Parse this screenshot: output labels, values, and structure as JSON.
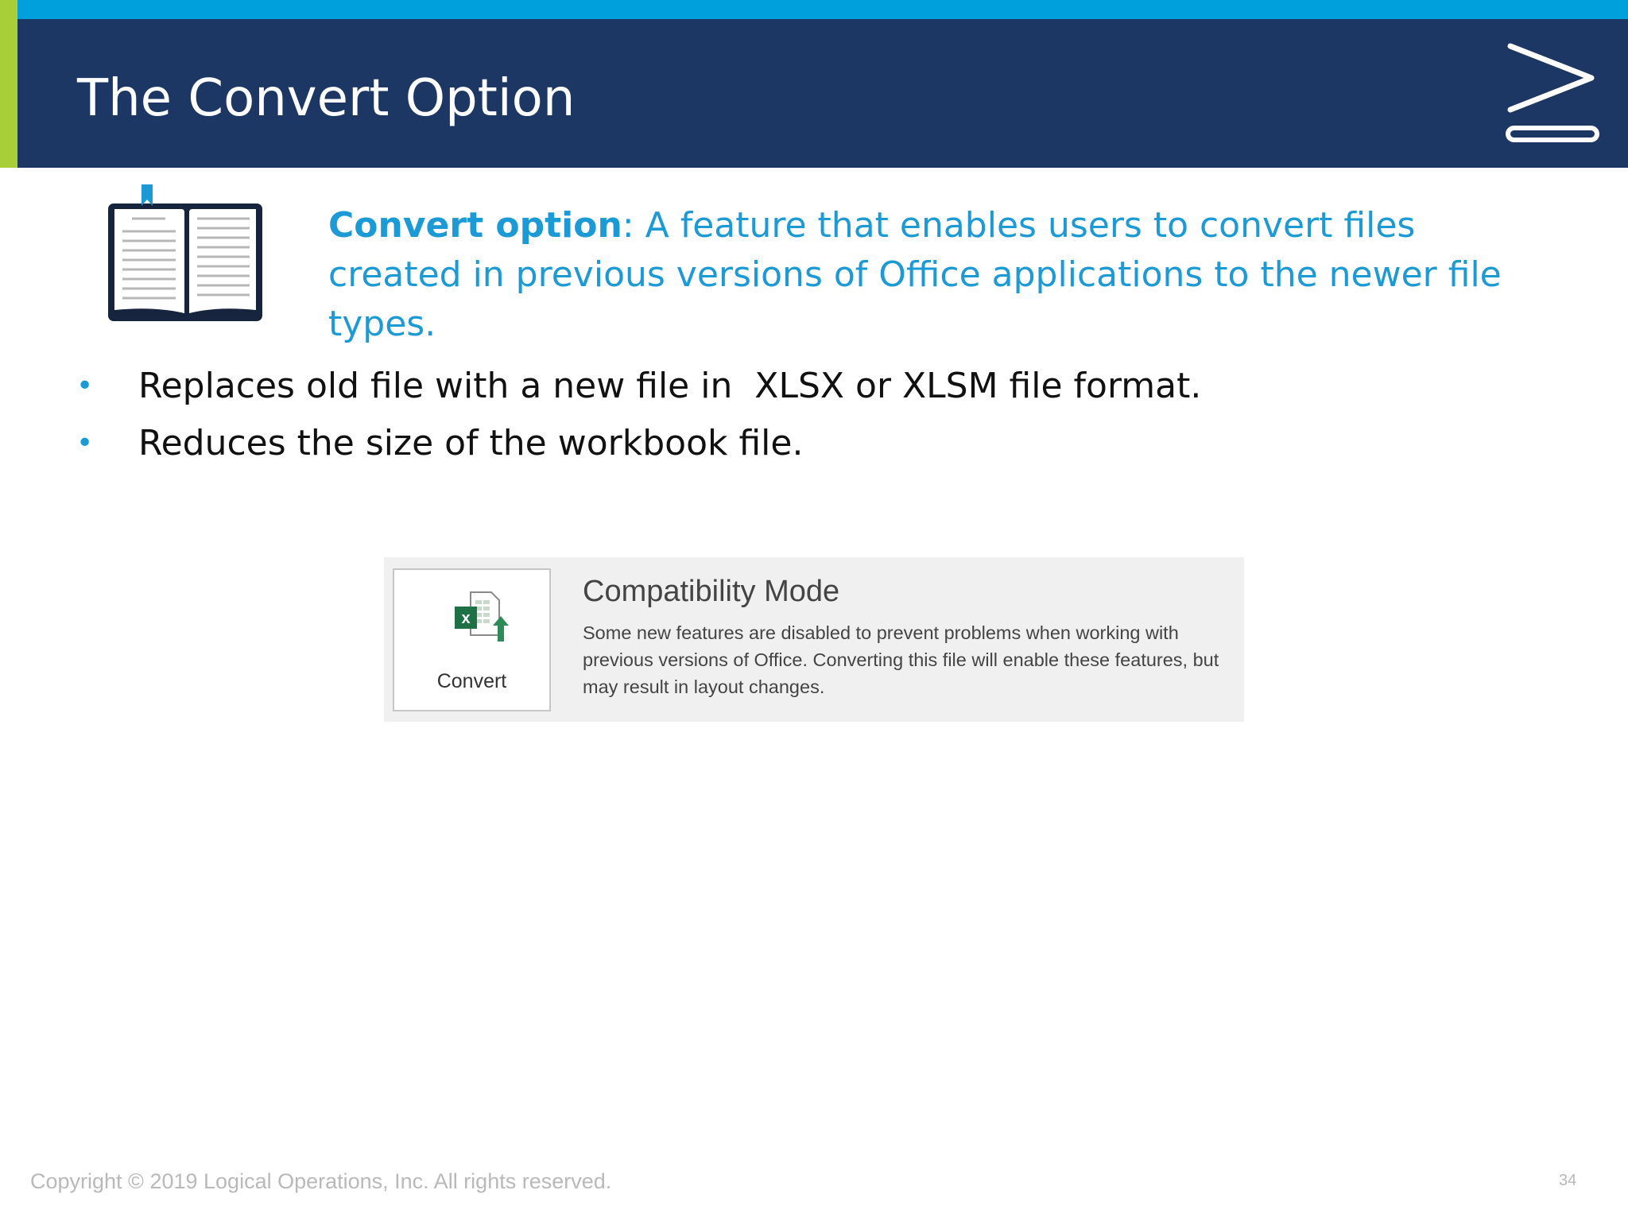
{
  "slide": {
    "title": "The Convert Option",
    "definition": {
      "term": "Convert option",
      "text": ": A feature that enables users to convert files created in previous versions of Office applications to the newer file types."
    },
    "bullets": [
      "Replaces old file with a new file in  XLSX or XLSM file format.",
      "Reduces the size of the workbook file."
    ],
    "bullet_symbol": "•"
  },
  "compatibility_panel": {
    "button_label": "Convert",
    "title": "Compatibility Mode",
    "description": "Some new features are disabled to prevent problems when working with previous versions of Office. Converting this file will enable these features, but may result in layout changes."
  },
  "footer": {
    "copyright": "Copyright © 2019 Logical Operations, Inc. All rights reserved.",
    "page_number": "34"
  },
  "icons": {
    "brand": "chevron-logo-icon",
    "book": "open-book-icon",
    "convert": "excel-convert-icon"
  },
  "colors": {
    "header_bg": "#1c3764",
    "top_stripe": "#00a0dc",
    "left_accent": "#a8cf38",
    "definition_text": "#1b9ad6",
    "bullet": "#1b9ad6"
  }
}
